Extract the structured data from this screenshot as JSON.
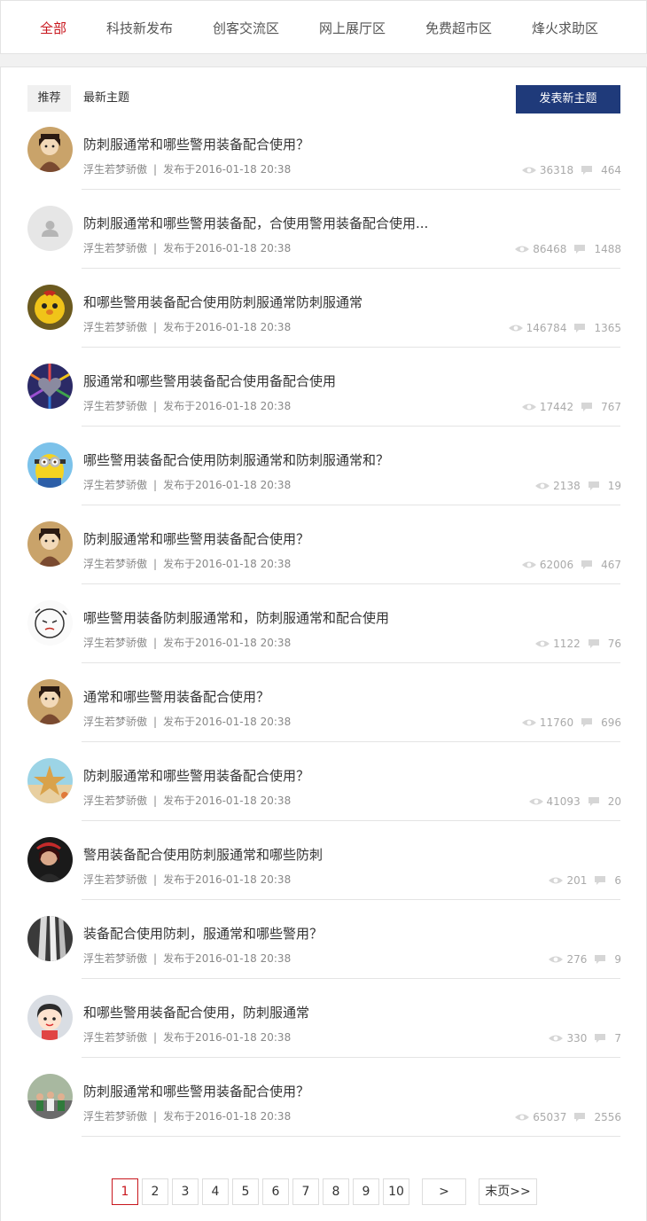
{
  "nav": {
    "items": [
      {
        "label": "全部",
        "active": true
      },
      {
        "label": "科技新发布"
      },
      {
        "label": "创客交流区"
      },
      {
        "label": "网上展厅区"
      },
      {
        "label": "免费超市区"
      },
      {
        "label": "烽火求助区"
      }
    ]
  },
  "toolbar": {
    "tab_recommend": "推荐",
    "tab_latest": "最新主题",
    "post_button": "发表新主题"
  },
  "posts": [
    {
      "title": "防刺服通常和哪些警用装备配合使用？",
      "author": "浮生若梦骄傲",
      "time": "发布于2016-01-18 20:38",
      "views": "36318",
      "comments": "464",
      "avatar": "girl-traditional"
    },
    {
      "title": "防刺服通常和哪些警用装备配，合使用警用装备配合使用...",
      "author": "浮生若梦骄傲",
      "time": "发布于2016-01-18 20:38",
      "views": "86468",
      "comments": "1488",
      "avatar": "default-user-icon"
    },
    {
      "title": "和哪些警用装备配合使用防刺服通常防刺服通常",
      "author": "浮生若梦骄傲",
      "time": "发布于2016-01-18 20:38",
      "views": "146784",
      "comments": "1365",
      "avatar": "yellow-chick"
    },
    {
      "title": "服通常和哪些警用装备配合使用备配合使用",
      "author": "浮生若梦骄傲",
      "time": "发布于2016-01-18 20:38",
      "views": "17442",
      "comments": "767",
      "avatar": "pencil-heart"
    },
    {
      "title": "哪些警用装备配合使用防刺服通常和防刺服通常和？",
      "author": "浮生若梦骄傲",
      "time": "发布于2016-01-18 20:38",
      "views": "2138",
      "comments": "19",
      "avatar": "minion"
    },
    {
      "title": "防刺服通常和哪些警用装备配合使用？",
      "author": "浮生若梦骄傲",
      "time": "发布于2016-01-18 20:38",
      "views": "62006",
      "comments": "467",
      "avatar": "girl-traditional"
    },
    {
      "title": "哪些警用装备防刺服通常和，防刺服通常和配合使用",
      "author": "浮生若梦骄傲",
      "time": "发布于2016-01-18 20:38",
      "views": "1122",
      "comments": "76",
      "avatar": "sketch-face"
    },
    {
      "title": "通常和哪些警用装备配合使用？",
      "author": "浮生若梦骄傲",
      "time": "发布于2016-01-18 20:38",
      "views": "11760",
      "comments": "696",
      "avatar": "girl-traditional"
    },
    {
      "title": "防刺服通常和哪些警用装备配合使用？",
      "author": "浮生若梦骄傲",
      "time": "发布于2016-01-18 20:38",
      "views": "41093",
      "comments": "20",
      "avatar": "starfish"
    },
    {
      "title": "警用装备配合使用防刺服通常和哪些防刺",
      "author": "浮生若梦骄傲",
      "time": "发布于2016-01-18 20:38",
      "views": "201",
      "comments": "6",
      "avatar": "dark-portrait"
    },
    {
      "title": "装备配合使用防刺，服通常和哪些警用？",
      "author": "浮生若梦骄傲",
      "time": "发布于2016-01-18 20:38",
      "views": "276",
      "comments": "9",
      "avatar": "waterfall"
    },
    {
      "title": "和哪些警用装备配合使用，防刺服通常",
      "author": "浮生若梦骄傲",
      "time": "发布于2016-01-18 20:38",
      "views": "330",
      "comments": "7",
      "avatar": "cartoon-girl"
    },
    {
      "title": "防刺服通常和哪些警用装备配合使用？",
      "author": "浮生若梦骄傲",
      "time": "发布于2016-01-18 20:38",
      "views": "65037",
      "comments": "2556",
      "avatar": "group-photo"
    }
  ],
  "pagination": {
    "pages": [
      "1",
      "2",
      "3",
      "4",
      "5",
      "6",
      "7",
      "8",
      "9",
      "10"
    ],
    "current": "1",
    "next_label": ">",
    "last_label": "末页>>"
  },
  "colors": {
    "accent_red": "#c8161d",
    "button_blue": "#1f3a7a"
  }
}
